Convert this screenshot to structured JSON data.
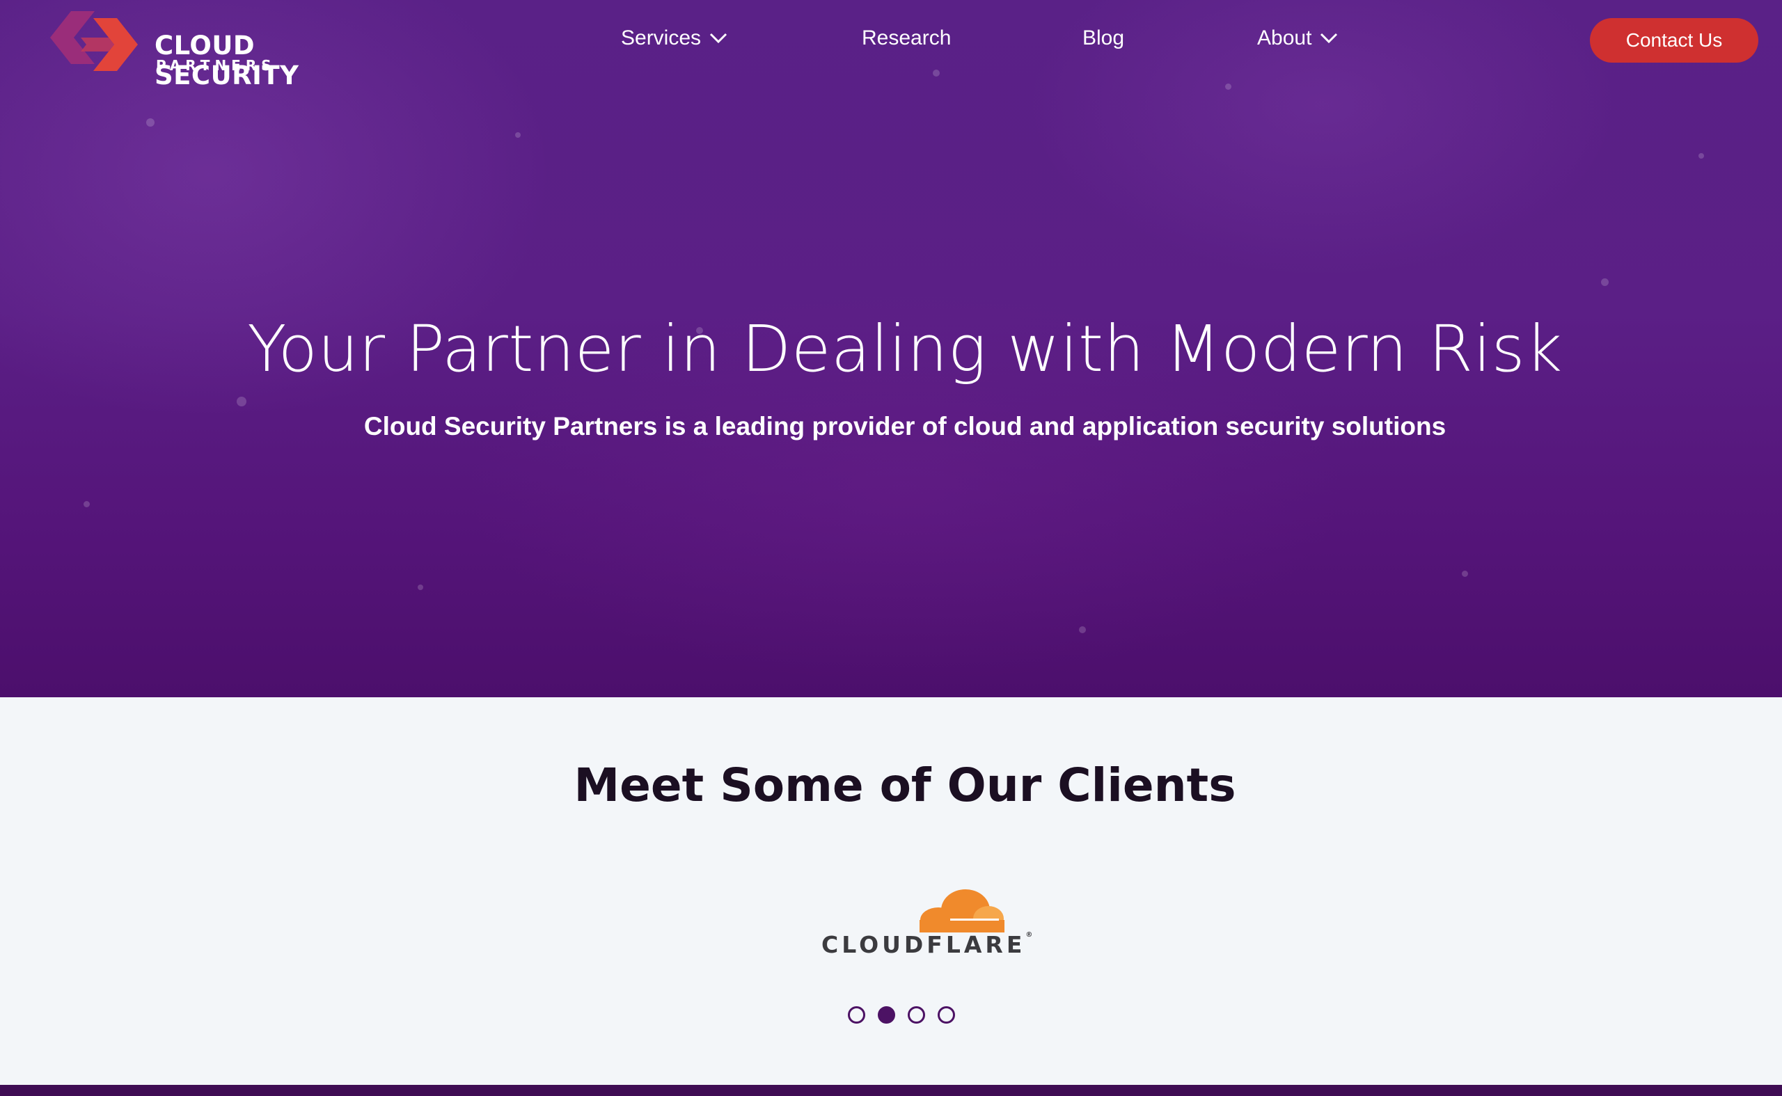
{
  "brand": {
    "name_line1": "CLOUD SECURITY",
    "name_line2": "PARTNERS",
    "logo_colors": [
      "#e2443a",
      "#9a2d7a"
    ]
  },
  "nav": {
    "items": [
      {
        "label": "Services",
        "has_dropdown": true,
        "icon": "chevron-down-icon"
      },
      {
        "label": "Research",
        "has_dropdown": false
      },
      {
        "label": "Blog",
        "has_dropdown": false
      },
      {
        "label": "About",
        "has_dropdown": true,
        "icon": "chevron-down-icon"
      }
    ],
    "cta_label": "Contact Us"
  },
  "hero": {
    "title": "Your Partner in Dealing with Modern Risk",
    "subtitle": "Cloud Security Partners is a leading provider of cloud and application security solutions"
  },
  "clients": {
    "title": "Meet Some of Our Clients",
    "current_logo_text": "CLOUDFLARE",
    "carousel": {
      "total": 4,
      "active_index": 1
    }
  },
  "colors": {
    "hero_bg": "#5a2187",
    "accent_button": "#cf3030",
    "carousel_dot": "#4c1264",
    "cloudflare_orange": "#f08a2c"
  }
}
